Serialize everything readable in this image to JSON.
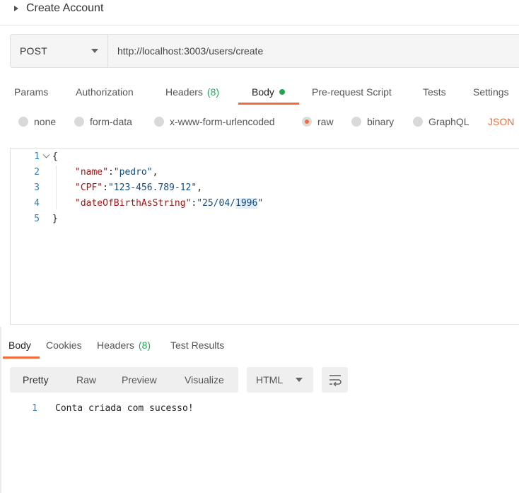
{
  "request": {
    "title": "Create Account",
    "method": "POST",
    "url": "http://localhost:3003/users/create"
  },
  "request_tabs": [
    {
      "label": "Params"
    },
    {
      "label": "Authorization"
    },
    {
      "label": "Headers",
      "count": "(8)"
    },
    {
      "label": "Body",
      "active": true
    },
    {
      "label": "Pre-request Script"
    },
    {
      "label": "Tests"
    },
    {
      "label": "Settings"
    }
  ],
  "body_types": [
    {
      "label": "none"
    },
    {
      "label": "form-data"
    },
    {
      "label": "x-www-form-urlencoded"
    },
    {
      "label": "raw",
      "checked": true
    },
    {
      "label": "binary"
    },
    {
      "label": "GraphQL"
    }
  ],
  "body_language": "JSON",
  "editor_lines": [
    {
      "n": "1",
      "text": "{"
    },
    {
      "n": "2",
      "key": "\"name\"",
      "value": "\"pedro\"",
      "trail": ","
    },
    {
      "n": "3",
      "key": "\"CPF\"",
      "value": "\"123-456.789-12\"",
      "trail": ","
    },
    {
      "n": "4",
      "key": "\"dateOfBirthAsString\"",
      "value_a": "\"25/04/",
      "value_hl": "1996",
      "value_b": "\""
    },
    {
      "n": "5",
      "text": "}"
    }
  ],
  "response_tabs": [
    {
      "label": "Body",
      "active": true
    },
    {
      "label": "Cookies"
    },
    {
      "label": "Headers",
      "count": "(8)"
    },
    {
      "label": "Test Results"
    }
  ],
  "view_modes": [
    {
      "label": "Pretty",
      "active": true
    },
    {
      "label": "Raw"
    },
    {
      "label": "Preview"
    },
    {
      "label": "Visualize"
    }
  ],
  "response_format": "HTML",
  "response_lines": [
    {
      "n": "1",
      "text": "Conta criada com sucesso!"
    }
  ],
  "colors": {
    "accent": "#f26b3a",
    "status_dot": "#22a64a",
    "count": "#26a65b",
    "line_number": "#2b7fb3",
    "json_key": "#a31515",
    "json_string": "#0f4c81"
  }
}
